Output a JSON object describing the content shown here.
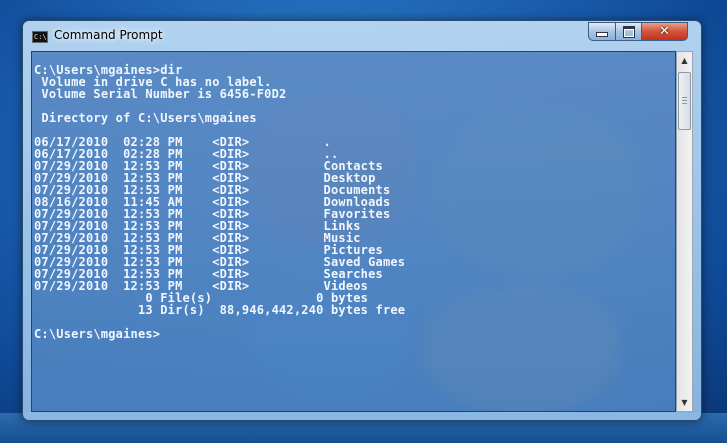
{
  "window": {
    "title": "Command Prompt",
    "app_icon_text": "C:\\"
  },
  "controls": {
    "minimize": "minimize",
    "maximize": "maximize",
    "close": "✕"
  },
  "console": {
    "lines": [
      "C:\\Users\\mgaines>dir",
      " Volume in drive C has no label.",
      " Volume Serial Number is 6456-F0D2",
      "",
      " Directory of C:\\Users\\mgaines",
      "",
      "06/17/2010  02:28 PM    <DIR>          .",
      "06/17/2010  02:28 PM    <DIR>          ..",
      "07/29/2010  12:53 PM    <DIR>          Contacts",
      "07/29/2010  12:53 PM    <DIR>          Desktop",
      "07/29/2010  12:53 PM    <DIR>          Documents",
      "08/16/2010  11:45 AM    <DIR>          Downloads",
      "07/29/2010  12:53 PM    <DIR>          Favorites",
      "07/29/2010  12:53 PM    <DIR>          Links",
      "07/29/2010  12:53 PM    <DIR>          Music",
      "07/29/2010  12:53 PM    <DIR>          Pictures",
      "07/29/2010  12:53 PM    <DIR>          Saved Games",
      "07/29/2010  12:53 PM    <DIR>          Searches",
      "07/29/2010  12:53 PM    <DIR>          Videos",
      "               0 File(s)              0 bytes",
      "              13 Dir(s)  88,946,442,240 bytes free",
      "",
      "C:\\Users\\mgaines>"
    ]
  },
  "scrollbar": {
    "up_arrow": "▲",
    "down_arrow": "▼"
  }
}
